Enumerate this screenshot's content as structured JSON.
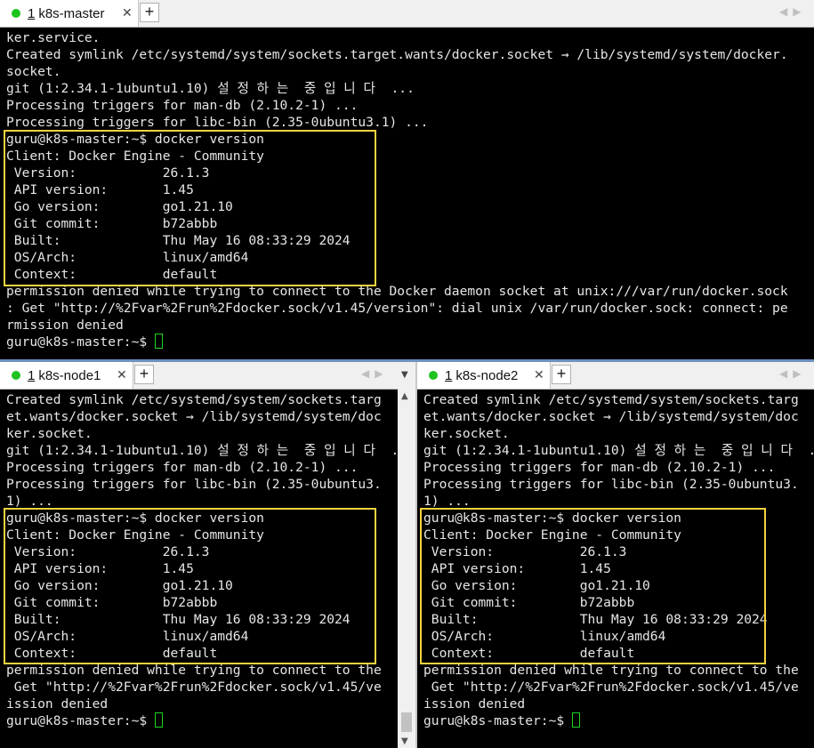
{
  "master": {
    "tab": {
      "number": "1",
      "title": "k8s-master",
      "close": "✕",
      "add": "+"
    },
    "lines": [
      "ker.service.",
      "Created symlink /etc/systemd/system/sockets.target.wants/docker.socket → /lib/systemd/system/docker.",
      "socket.",
      "git (1:2.34.1-1ubuntu1.10) 설 정 하 는  중 입 니 다  ...",
      "Processing triggers for man-db (2.10.2-1) ...",
      "Processing triggers for libc-bin (2.35-0ubuntu3.1) ...",
      "guru@k8s-master:~$ docker version",
      "Client: Docker Engine - Community",
      " Version:           26.1.3",
      " API version:       1.45",
      " Go version:        go1.21.10",
      " Git commit:        b72abbb",
      " Built:             Thu May 16 08:33:29 2024",
      " OS/Arch:           linux/amd64",
      " Context:           default",
      "permission denied while trying to connect to the Docker daemon socket at unix:///var/run/docker.sock",
      ": Get \"http://%2Fvar%2Frun%2Fdocker.sock/v1.45/version\": dial unix /var/run/docker.sock: connect: pe",
      "rmission denied"
    ],
    "prompt": "guru@k8s-master:~$ "
  },
  "node1": {
    "tab": {
      "number": "1",
      "title": "k8s-node1",
      "close": "✕",
      "add": "+"
    },
    "lines": [
      "Created symlink /etc/systemd/system/sockets.targ",
      "et.wants/docker.socket → /lib/systemd/system/doc",
      "ker.socket.",
      "git (1:2.34.1-1ubuntu1.10) 설 정 하 는  중 입 니 다  ...",
      "Processing triggers for man-db (2.10.2-1) ...",
      "Processing triggers for libc-bin (2.35-0ubuntu3.",
      "1) ...",
      "guru@k8s-master:~$ docker version",
      "Client: Docker Engine - Community",
      " Version:           26.1.3",
      " API version:       1.45",
      " Go version:        go1.21.10",
      " Git commit:        b72abbb",
      " Built:             Thu May 16 08:33:29 2024",
      " OS/Arch:           linux/amd64",
      " Context:           default",
      "permission denied while trying to connect to the",
      " Get \"http://%2Fvar%2Frun%2Fdocker.sock/v1.45/ve",
      "ission denied"
    ],
    "prompt": "guru@k8s-master:~$ "
  },
  "node2": {
    "tab": {
      "number": "1",
      "title": "k8s-node2",
      "close": "✕",
      "add": "+"
    },
    "lines": [
      "Created symlink /etc/systemd/system/sockets.targ",
      "et.wants/docker.socket → /lib/systemd/system/doc",
      "ker.socket.",
      "git (1:2.34.1-1ubuntu1.10) 설 정 하 는  중 입 니 다  ...",
      "Processing triggers for man-db (2.10.2-1) ...",
      "Processing triggers for libc-bin (2.35-0ubuntu3.",
      "1) ...",
      "guru@k8s-master:~$ docker version",
      "Client: Docker Engine - Community",
      " Version:           26.1.3",
      " API version:       1.45",
      " Go version:        go1.21.10",
      " Git commit:        b72abbb",
      " Built:             Thu May 16 08:33:29 2024",
      " OS/Arch:           linux/amd64",
      " Context:           default",
      "permission denied while trying to connect to the",
      " Get \"http://%2Fvar%2Frun%2Fdocker.sock/v1.45/ve",
      "ission denied"
    ],
    "prompt": "guru@k8s-master:~$ "
  },
  "nav_arrows": "◀▶",
  "dropdown_arrow": "▼",
  "scroll_up": "▲",
  "scroll_down": "▼",
  "colors": {
    "terminal_bg": "#000000",
    "terminal_fg": "#e6e6e6",
    "highlight": "#f2d340",
    "cursor": "#1fd51f",
    "tab_dot": "#1ec31e"
  }
}
